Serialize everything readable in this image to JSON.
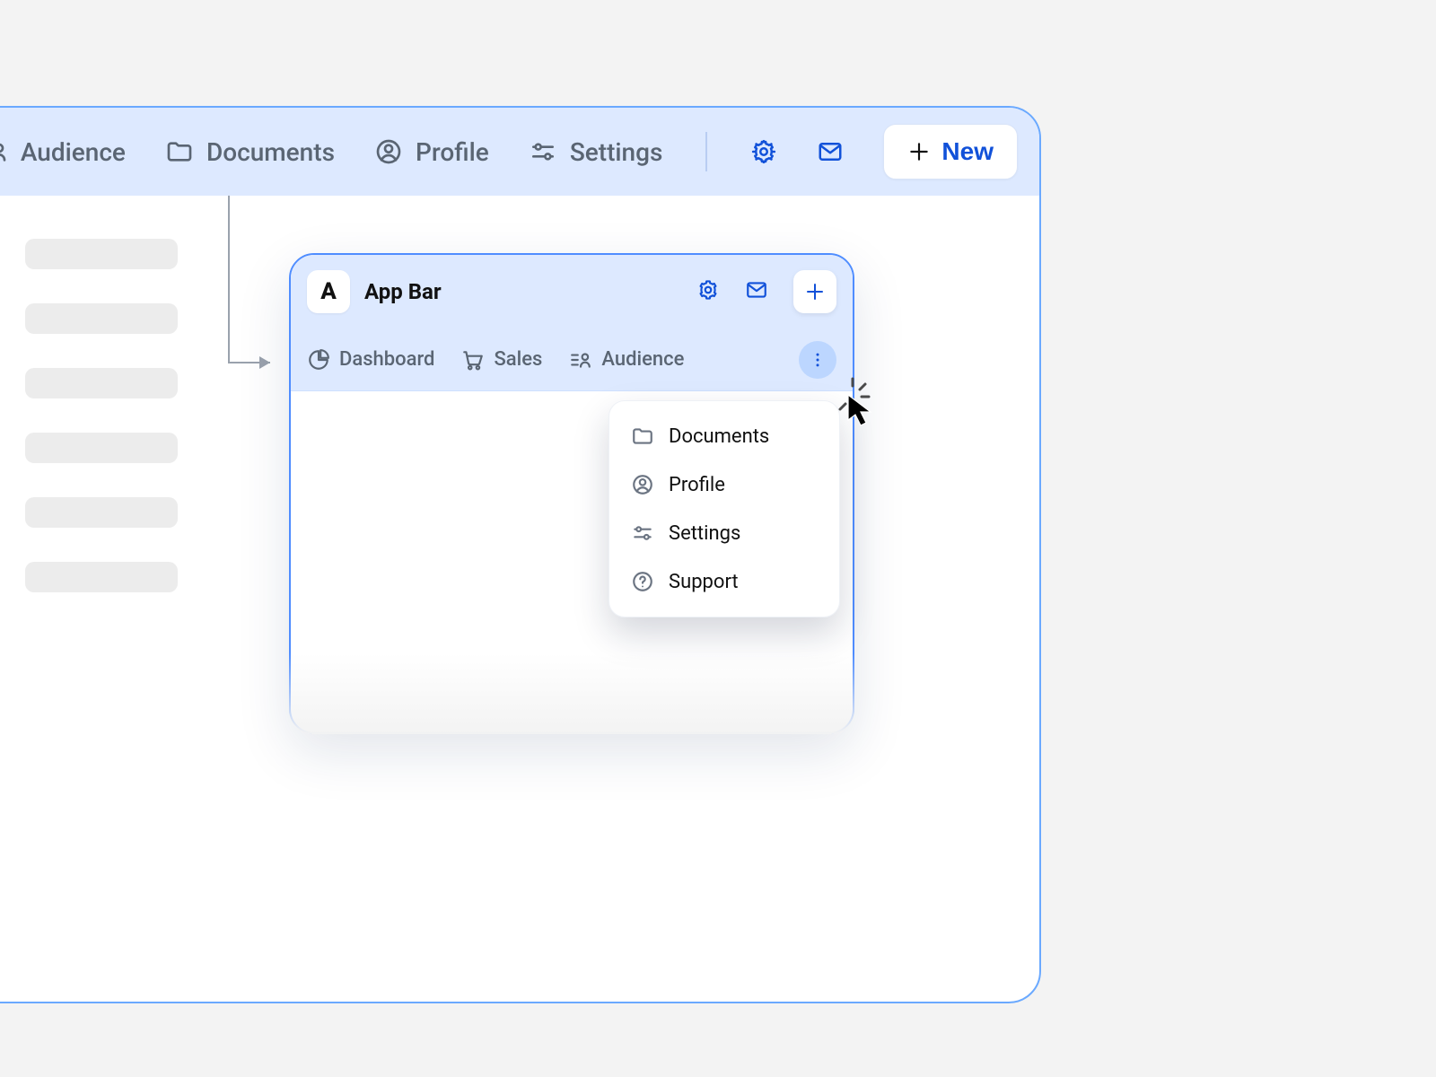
{
  "colors": {
    "accent": "#1151d9",
    "panel": "#dde9ff",
    "border": "#4f8dff",
    "muted": "#5a6573"
  },
  "big_window": {
    "nav": {
      "audience": "Audience",
      "documents": "Documents",
      "profile": "Profile",
      "settings": "Settings"
    },
    "new_button_label": "New"
  },
  "small_window": {
    "logo_letter": "A",
    "title": "App Bar",
    "tabs": {
      "dashboard": "Dashboard",
      "sales": "Sales",
      "audience": "Audience"
    }
  },
  "dropdown": {
    "documents": "Documents",
    "profile": "Profile",
    "settings": "Settings",
    "support": "Support"
  }
}
